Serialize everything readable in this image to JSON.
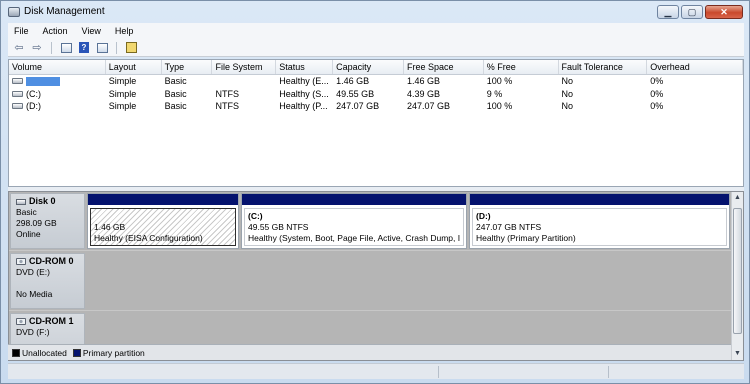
{
  "window": {
    "title": "Disk Management",
    "caption": {
      "minimize": "▁",
      "maximize": "▢",
      "close": "✕"
    }
  },
  "menu": [
    "File",
    "Action",
    "View",
    "Help"
  ],
  "toolbar": {
    "icons": [
      "back-arrow-icon",
      "forward-arrow-icon",
      "console-tree-icon",
      "help-icon",
      "show-hide-icon",
      "properties-icon"
    ],
    "back": "⇦",
    "forward": "⇨",
    "help": "?"
  },
  "volume_table": {
    "columns": [
      "Volume",
      "Layout",
      "Type",
      "File System",
      "Status",
      "Capacity",
      "Free Space",
      "% Free",
      "Fault Tolerance",
      "Overhead"
    ],
    "rows": [
      {
        "volume": "",
        "redacted": true,
        "layout": "Simple",
        "type": "Basic",
        "fs": "",
        "status": "Healthy (E...",
        "capacity": "1.46 GB",
        "free": "1.46 GB",
        "pct": "100 %",
        "fault": "No",
        "overhead": "0%"
      },
      {
        "volume": "(C:)",
        "redacted": false,
        "layout": "Simple",
        "type": "Basic",
        "fs": "NTFS",
        "status": "Healthy (S...",
        "capacity": "49.55 GB",
        "free": "4.39 GB",
        "pct": "9 %",
        "fault": "No",
        "overhead": "0%"
      },
      {
        "volume": "(D:)",
        "redacted": false,
        "layout": "Simple",
        "type": "Basic",
        "fs": "NTFS",
        "status": "Healthy (P...",
        "capacity": "247.07 GB",
        "free": "247.07 GB",
        "pct": "100 %",
        "fault": "No",
        "overhead": "0%"
      }
    ]
  },
  "disks": [
    {
      "name": "Disk 0",
      "lines": [
        "Basic",
        "298.09 GB",
        "Online"
      ],
      "partitions": [
        {
          "title": "",
          "size": "1.46 GB",
          "status": "Healthy (EISA Configuration)",
          "hatched": true,
          "selected": true
        },
        {
          "title": "(C:)",
          "size": "49.55 GB NTFS",
          "status": "Healthy (System, Boot, Page File, Active, Crash Dump, I",
          "hatched": false,
          "selected": false
        },
        {
          "title": "(D:)",
          "size": "247.07 GB NTFS",
          "status": "Healthy (Primary Partition)",
          "hatched": false,
          "selected": false
        }
      ]
    },
    {
      "name": "CD-ROM 0",
      "lines": [
        "DVD (E:)",
        "",
        "No Media"
      ],
      "partitions": []
    },
    {
      "name": "CD-ROM 1",
      "lines": [
        "DVD (F:)"
      ],
      "partitions": []
    }
  ],
  "legend": [
    {
      "label": "Unallocated",
      "color": "#000000"
    },
    {
      "label": "Primary partition",
      "color": "#04126e"
    }
  ],
  "colors": {
    "partition_bar": "#04126e",
    "redaction": "#4f8fe2"
  }
}
